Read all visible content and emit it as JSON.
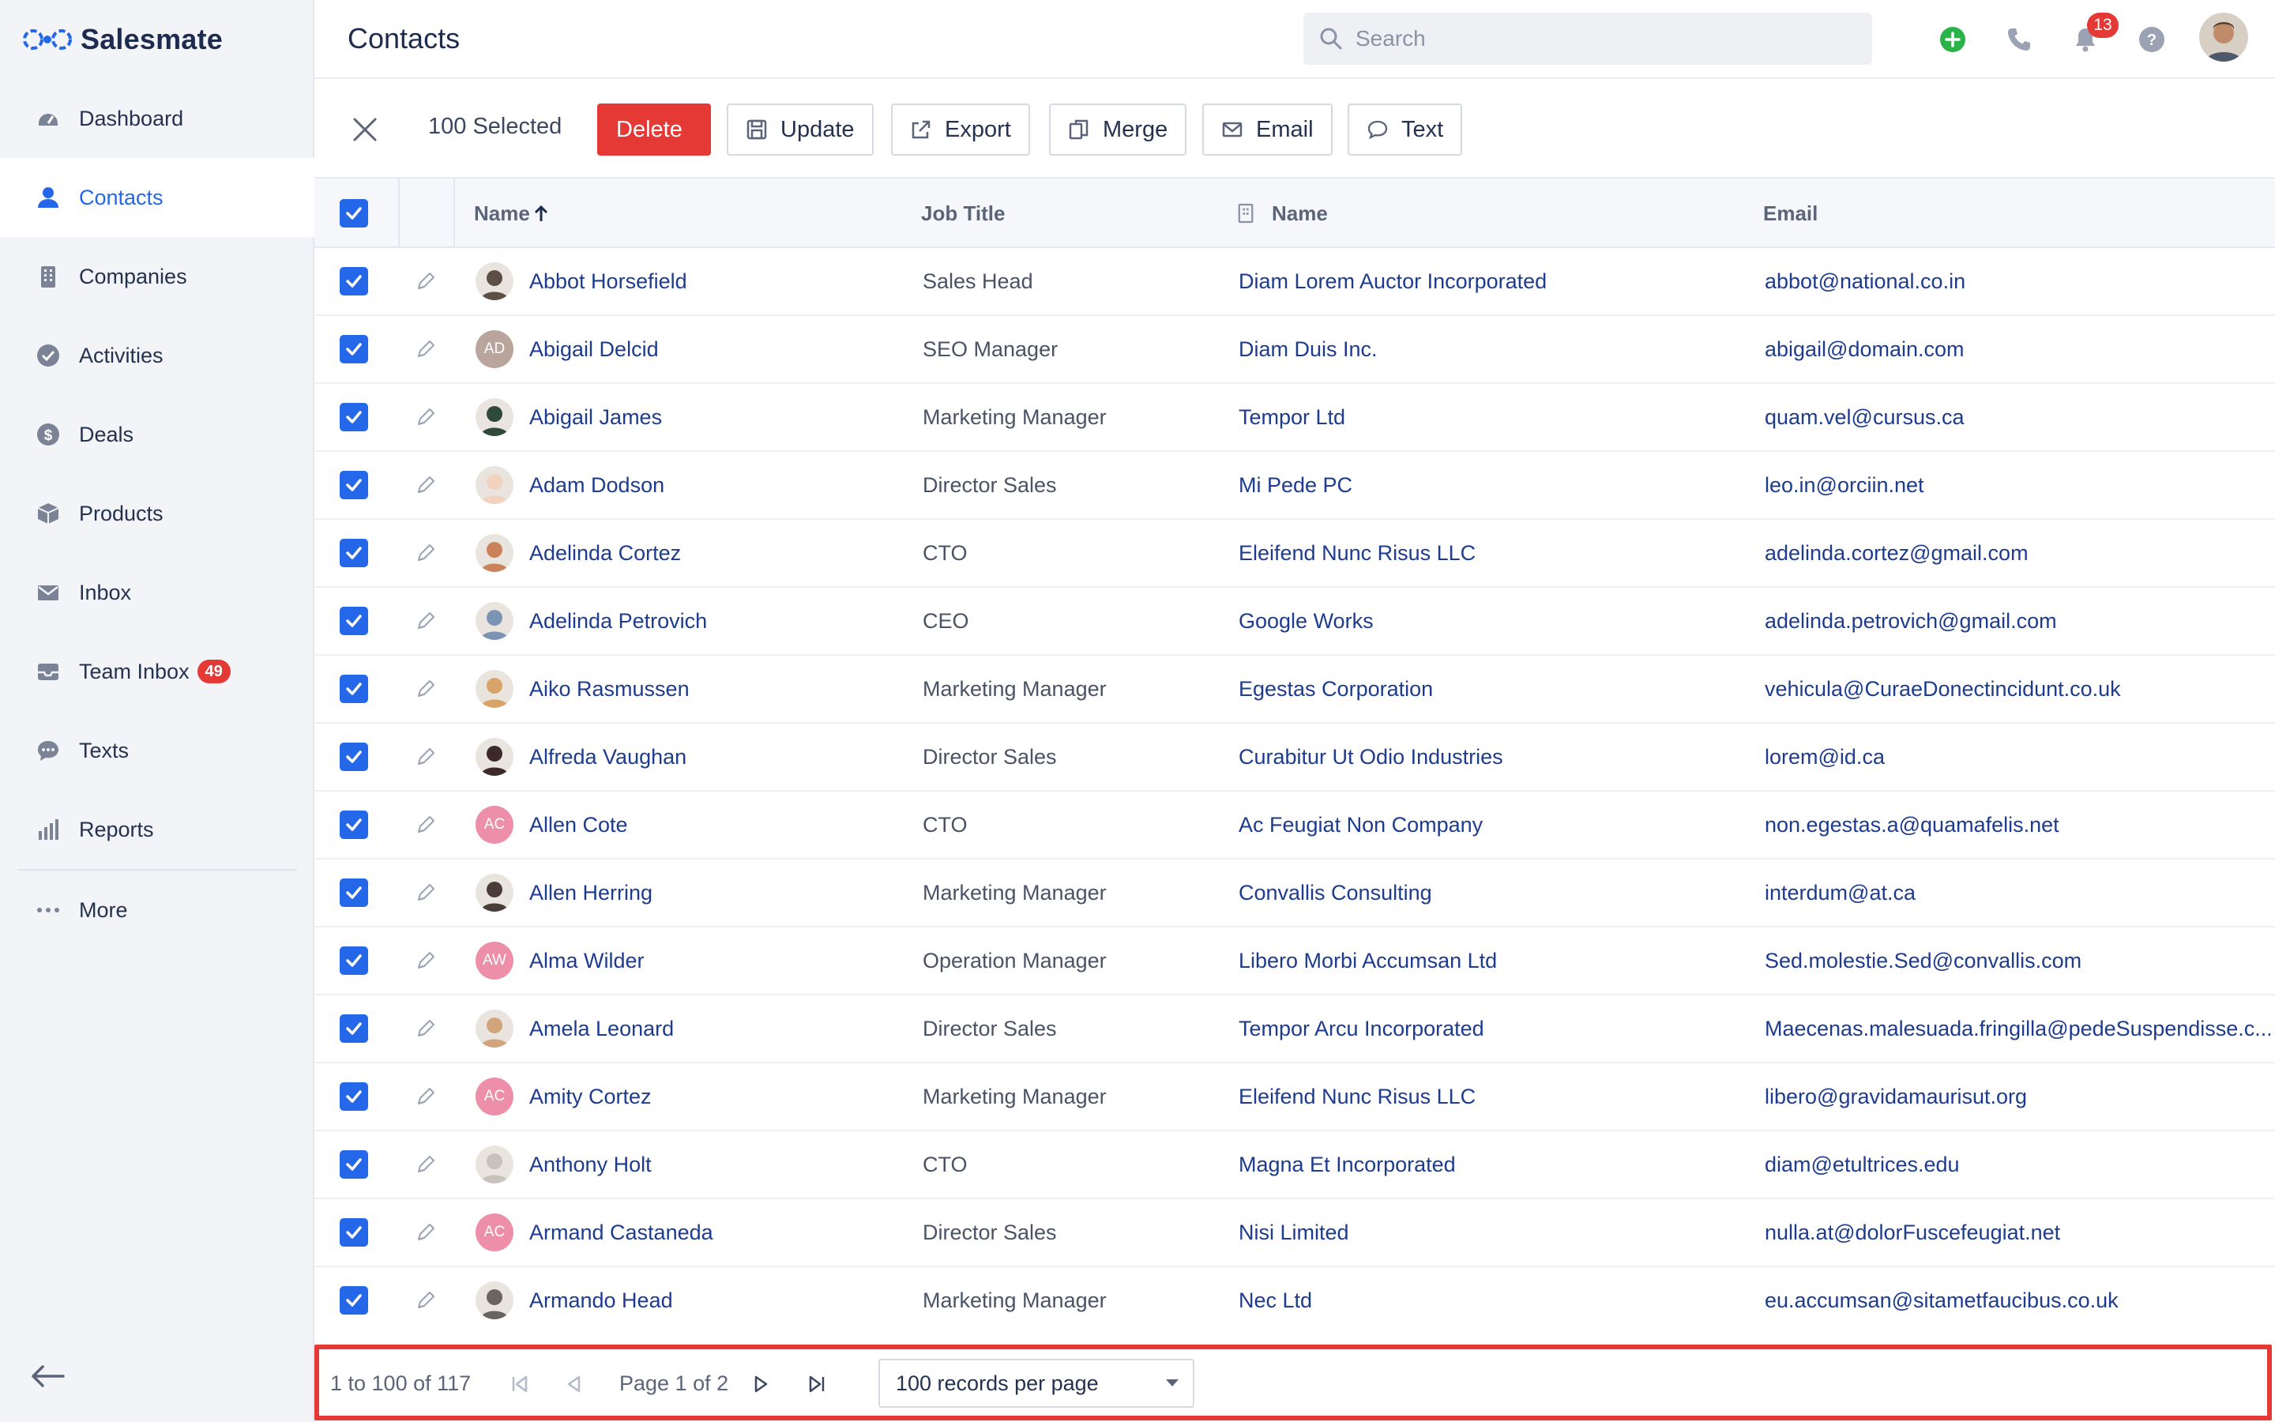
{
  "app": {
    "name": "Salesmate"
  },
  "sidebar": {
    "items": [
      {
        "label": "Dashboard",
        "icon": "dashboard-icon"
      },
      {
        "label": "Contacts",
        "icon": "person-icon",
        "active": true
      },
      {
        "label": "Companies",
        "icon": "building-icon"
      },
      {
        "label": "Activities",
        "icon": "check-circle-icon"
      },
      {
        "label": "Deals",
        "icon": "dollar-icon"
      },
      {
        "label": "Products",
        "icon": "box-icon"
      },
      {
        "label": "Inbox",
        "icon": "mail-icon"
      },
      {
        "label": "Team Inbox",
        "icon": "inbox-tray-icon",
        "badge": "49"
      },
      {
        "label": "Texts",
        "icon": "chat-bubble-icon"
      },
      {
        "label": "Reports",
        "icon": "bar-chart-icon"
      },
      {
        "label": "More",
        "icon": "more-dots-icon"
      }
    ]
  },
  "header": {
    "title": "Contacts",
    "search_placeholder": "Search",
    "notifications_count": "13"
  },
  "toolbar": {
    "selected_text": "100 Selected",
    "buttons": {
      "delete": "Delete",
      "update": "Update",
      "export": "Export",
      "merge": "Merge",
      "email": "Email",
      "text": "Text"
    }
  },
  "table": {
    "columns": {
      "name": "Name",
      "job_title": "Job Title",
      "company_name": "Name",
      "email": "Email"
    },
    "rows": [
      {
        "name": "Abbot Horsefield",
        "job": "Sales Head",
        "company": "Diam Lorem Auctor Incorporated",
        "email": "abbot@national.co.in",
        "avatar": "photo",
        "color": "#5d4e46"
      },
      {
        "name": "Abigail Delcid",
        "job": "SEO Manager",
        "company": "Diam Duis Inc.",
        "email": "abigail@domain.com",
        "avatar": "AD",
        "color": "#b9a59b"
      },
      {
        "name": "Abigail James",
        "job": "Marketing Manager",
        "company": "Tempor Ltd",
        "email": "quam.vel@cursus.ca",
        "avatar": "photo",
        "color": "#2f4a3b"
      },
      {
        "name": "Adam Dodson",
        "job": "Director Sales",
        "company": "Mi Pede PC",
        "email": "leo.in@orciin.net",
        "avatar": "photo",
        "color": "#f1d3bf"
      },
      {
        "name": "Adelinda Cortez",
        "job": "CTO",
        "company": "Eleifend Nunc Risus LLC",
        "email": "adelinda.cortez@gmail.com",
        "avatar": "photo",
        "color": "#c9825a"
      },
      {
        "name": "Adelinda Petrovich",
        "job": "CEO",
        "company": "Google Works",
        "email": "adelinda.petrovich@gmail.com",
        "avatar": "photo",
        "color": "#7c93b4"
      },
      {
        "name": "Aiko Rasmussen",
        "job": "Marketing Manager",
        "company": "Egestas Corporation",
        "email": "vehicula@CuraeDonectincidunt.co.uk",
        "avatar": "photo",
        "color": "#d9a46a"
      },
      {
        "name": "Alfreda Vaughan",
        "job": "Director Sales",
        "company": "Curabitur Ut Odio Industries",
        "email": "lorem@id.ca",
        "avatar": "photo",
        "color": "#3b2a26"
      },
      {
        "name": "Allen Cote",
        "job": "CTO",
        "company": "Ac Feugiat Non Company",
        "email": "non.egestas.a@quamafelis.net",
        "avatar": "AC",
        "color": "#ee8fa9"
      },
      {
        "name": "Allen Herring",
        "job": "Marketing Manager",
        "company": "Convallis Consulting",
        "email": "interdum@at.ca",
        "avatar": "photo",
        "color": "#4a3d37"
      },
      {
        "name": "Alma Wilder",
        "job": "Operation Manager",
        "company": "Libero Morbi Accumsan Ltd",
        "email": "Sed.molestie.Sed@convallis.com",
        "avatar": "AW",
        "color": "#ee8fa9"
      },
      {
        "name": "Amela Leonard",
        "job": "Director Sales",
        "company": "Tempor Arcu Incorporated",
        "email": "Maecenas.malesuada.fringilla@pedeSuspendisse.c...",
        "avatar": "photo",
        "color": "#d2a47c"
      },
      {
        "name": "Amity Cortez",
        "job": "Marketing Manager",
        "company": "Eleifend Nunc Risus LLC",
        "email": "libero@gravidamaurisut.org",
        "avatar": "AC",
        "color": "#ee8fa9"
      },
      {
        "name": "Anthony Holt",
        "job": "CTO",
        "company": "Magna Et Incorporated",
        "email": "diam@etultrices.edu",
        "avatar": "photo",
        "color": "#c8c2bc"
      },
      {
        "name": "Armand Castaneda",
        "job": "Director Sales",
        "company": "Nisi Limited",
        "email": "nulla.at@dolorFuscefeugiat.net",
        "avatar": "AC",
        "color": "#ee8fa9"
      },
      {
        "name": "Armando Head",
        "job": "Marketing Manager",
        "company": "Nec Ltd",
        "email": "eu.accumsan@sitametfaucibus.co.uk",
        "avatar": "photo",
        "color": "#6b6561"
      }
    ]
  },
  "pagination": {
    "range": "1 to 100 of 117",
    "page_label": "Page 1 of 2",
    "per_page": "100 records per page"
  },
  "colors": {
    "accent": "#2467e8",
    "danger": "#e53935",
    "link": "#1d3b8f"
  }
}
